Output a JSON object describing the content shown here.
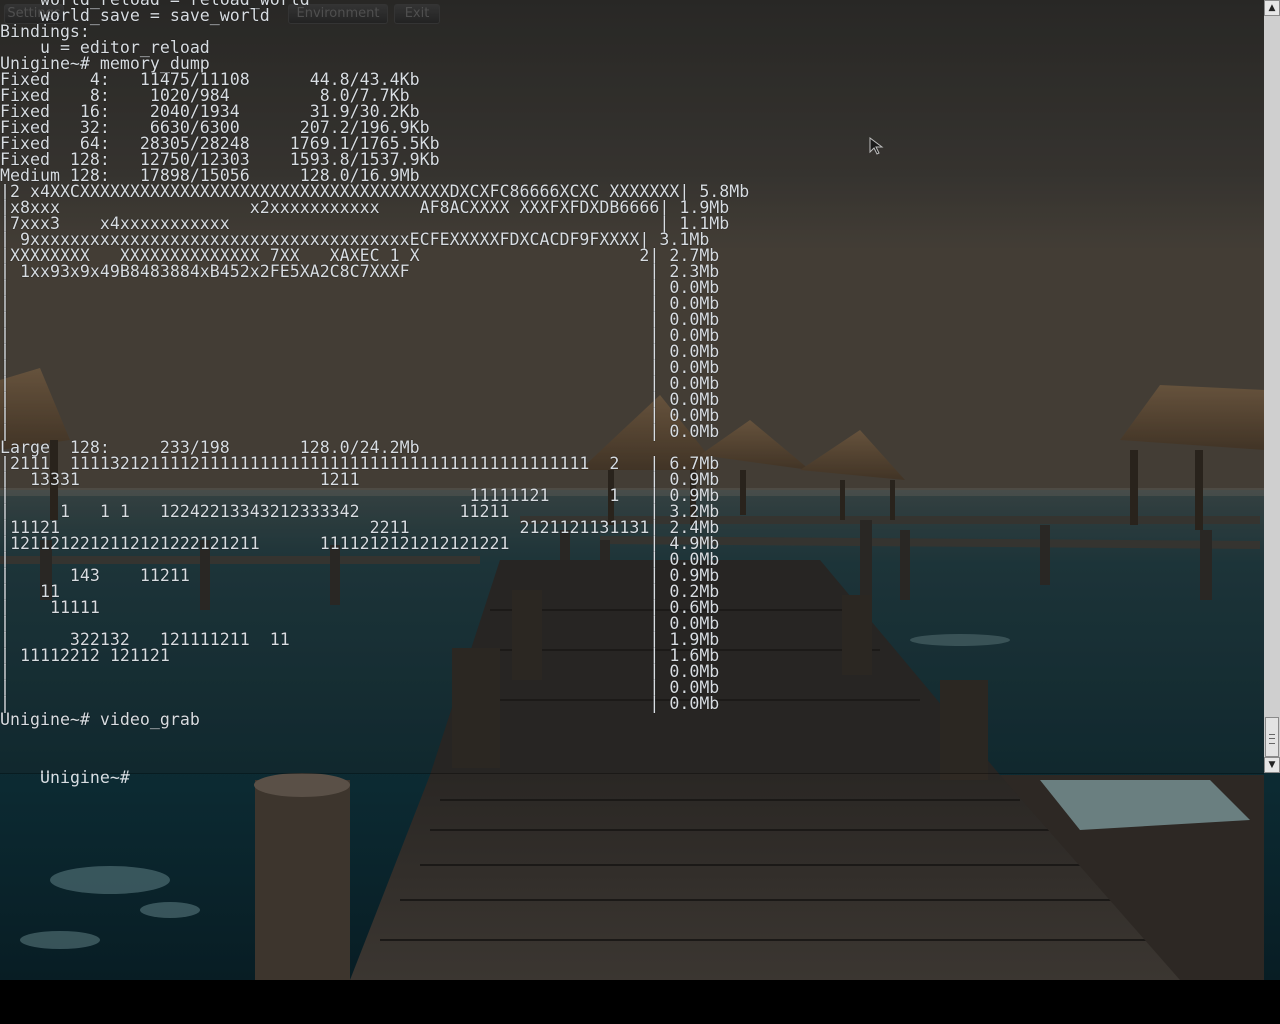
{
  "toolbar": {
    "buttons": [
      "Settings",
      "Environment",
      "Exit"
    ]
  },
  "console": {
    "lines": [
      "    world_reload = reload_world",
      "    world_save = save_world",
      "Bindings:",
      "    u = editor_reload",
      "Unigine~# memory_dump",
      "Fixed    4:   11475/11108      44.8/43.4Kb",
      "Fixed    8:    1020/984         8.0/7.7Kb",
      "Fixed   16:    2040/1934       31.9/30.2Kb",
      "Fixed   32:    6630/6300      207.2/196.9Kb",
      "Fixed   64:   28305/28248    1769.1/1765.5Kb",
      "Fixed  128:   12750/12303    1593.8/1537.9Kb",
      "Medium 128:   17898/15056     128.0/16.9Mb",
      "|2 x4XXCXXXXXXXXXXXXXXXXXXXXXXXXXXXXXXXXXXXXXDXCXFC86666XCXC XXXXXXX| 5.8Mb",
      "|x8xxx                   x2xxxxxxxxxxx    AF8ACXXXX XXXFXFDXDB6666| 1.9Mb",
      "|7xxx3    x4xxxxxxxxxxx                                           | 1.1Mb",
      "| 9xxxxxxxxxxxxxxxxxxxxxxxxxxxxxxxxxxxxxxECFEXXXXXFDXCACDF9FXXXX| 3.1Mb",
      "|XXXXXXXX   XXXXXXXXXXXXXX 7XX   XAXEC 1 X                      2| 2.7Mb",
      "| 1xx93x9x49B8483884xB452x2FE5XA2C8C7XXXF                        | 2.3Mb",
      "|                                                                | 0.0Mb",
      "|                                                                | 0.0Mb",
      "|                                                                | 0.0Mb",
      "|                                                                | 0.0Mb",
      "|                                                                | 0.0Mb",
      "|                                                                | 0.0Mb",
      "|                                                                | 0.0Mb",
      "|                                                                | 0.0Mb",
      "|                                                                | 0.0Mb",
      "|                                                                | 0.0Mb",
      "Large  128:     233/198       128.0/24.2Mb",
      "|2111  1111321211112111111111111111111111111111111111111111  2   | 6.7Mb",
      "|  13331                        1211                             | 0.9Mb",
      "|                                              11111121      1   | 0.9Mb",
      "|     1   1 1   12242213343212333342          11211              | 3.2Mb",
      "|11121                               2211           2121121131131| 2.4Mb",
      "|1211212212112121222121211      1111212121212121221              | 4.9Mb",
      "|                                                                | 0.0Mb",
      "|      143    11211                                              | 0.9Mb",
      "|   11                                                           | 0.2Mb",
      "|    11111                                                       | 0.6Mb",
      "|                                                                | 0.0Mb",
      "|      322132   121111211  11                                    | 1.9Mb",
      "| 11112212 121121                                                | 1.6Mb",
      "|                                                                | 0.0Mb",
      "|                                                                | 0.0Mb",
      "|                                                                | 0.0Mb",
      "Unigine~# video_grab"
    ],
    "prompt": "Unigine~#"
  },
  "colors": {
    "console_text": "#d8dde2",
    "sky_top": "#2f2f2c",
    "water": "#0f2a31"
  },
  "icons": {
    "scroll_up": "▲",
    "scroll_down": "▼",
    "cursor": "arrow-cursor-icon"
  }
}
